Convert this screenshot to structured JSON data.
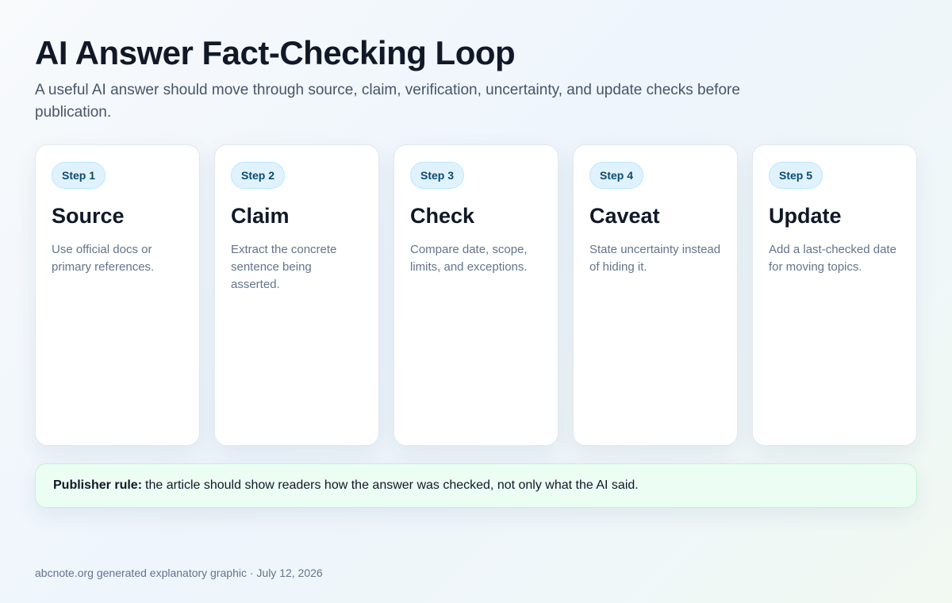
{
  "header": {
    "title": "AI Answer Fact-Checking Loop",
    "subtitle": "A useful AI answer should move through source, claim, verification, uncertainty, and update checks before publication."
  },
  "steps": [
    {
      "badge": "Step 1",
      "title": "Source",
      "description": "Use official docs or primary references."
    },
    {
      "badge": "Step 2",
      "title": "Claim",
      "description": "Extract the concrete sentence being asserted."
    },
    {
      "badge": "Step 3",
      "title": "Check",
      "description": "Compare date, scope, limits, and exceptions."
    },
    {
      "badge": "Step 4",
      "title": "Caveat",
      "description": "State uncertainty instead of hiding it."
    },
    {
      "badge": "Step 5",
      "title": "Update",
      "description": "Add a last-checked date for moving topics."
    }
  ],
  "rule": {
    "label": "Publisher rule:",
    "text": "the article should show readers how the answer was checked, not only what the AI said."
  },
  "footer": {
    "text": "abcnote.org generated explanatory graphic · July 12, 2026"
  },
  "colors": {
    "badge_background": "#e0f2fe",
    "badge_text": "#0c4a6e",
    "rule_background": "#ecfdf3",
    "rule_border": "#bbf7d0"
  }
}
